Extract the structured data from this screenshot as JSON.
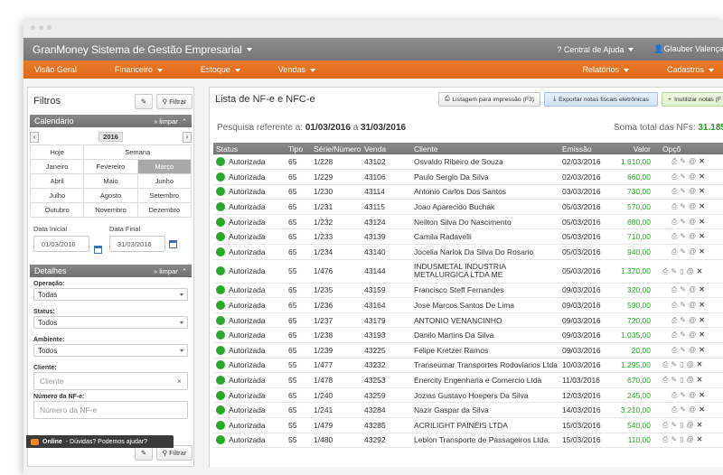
{
  "app": {
    "title": "GranMoney Sistema de Gestão Empresarial",
    "help": "Central de Ajuda",
    "user": "Glauber Valença"
  },
  "menu": {
    "left": [
      "Visão Geral",
      "Financeiro",
      "Estoque",
      "Vendas"
    ],
    "right": [
      "Relatórios",
      "Cadastros"
    ]
  },
  "sidebar": {
    "title": "Filtros",
    "filter_btn": "Filtrar",
    "calendar": {
      "title": "Calendário",
      "clear": "» limpar",
      "year": "2016",
      "quick": [
        "Hoje",
        "Semana"
      ],
      "months": [
        "Janeiro",
        "Fevereiro",
        "Março",
        "Abril",
        "Maio",
        "Junho",
        "Julho",
        "Agosto",
        "Setembro",
        "Outubro",
        "Novembro",
        "Dezembro"
      ],
      "selected_month": "Março",
      "start_label": "Data Inicial",
      "start_value": "01/03/2016",
      "end_label": "Data Final",
      "end_value": "31/03/2016"
    },
    "details": {
      "title": "Detalhes",
      "clear": "» limpar",
      "operacao_label": "Operação:",
      "operacao_value": "Todas",
      "status_label": "Status:",
      "status_value": "Todos",
      "ambiente_label": "Ambiente:",
      "ambiente_value": "Todos",
      "cliente_label": "Cliente:",
      "cliente_placeholder": "Cliente",
      "nf_label": "Número da NF-e:",
      "nf_placeholder": "Número da NF-e"
    }
  },
  "main": {
    "title": "Lista de NF-e e NFC-e",
    "actions": {
      "print": "Listagem para impressão (F3)",
      "export": "Exportar notas fiscais eletrônicas",
      "void": "Inutilizar notas (F"
    },
    "search_prefix": "Pesquisa referente a:",
    "date_from": "01/03/2016",
    "date_sep": "a",
    "date_to": "31/03/2016",
    "total_label": "Soma total das NFs:",
    "total_value": "31.185,",
    "columns": [
      "Status",
      "Tipo",
      "Série/Número",
      "Venda",
      "Cliente",
      "Emissão",
      "Valor",
      "Opçõ"
    ],
    "rows": [
      {
        "status": "Autorizada",
        "tipo": "65",
        "serie": "1/228",
        "venda": "43102",
        "cliente": "Osvaldo Ribeiro de Souza",
        "emissao": "02/03/2016",
        "valor": "1.610,00"
      },
      {
        "status": "Autorizada",
        "tipo": "65",
        "serie": "1/229",
        "venda": "43106",
        "cliente": "Paulo Sergio Da Silva",
        "emissao": "02/03/2016",
        "valor": "660,00"
      },
      {
        "status": "Autorizada",
        "tipo": "65",
        "serie": "1/230",
        "venda": "43114",
        "cliente": "Antonio Carlos Dos Santos",
        "emissao": "03/03/2016",
        "valor": "730,00"
      },
      {
        "status": "Autorizada",
        "tipo": "65",
        "serie": "1/231",
        "venda": "43115",
        "cliente": "Joao Aparecido Buchak",
        "emissao": "05/03/2016",
        "valor": "570,00"
      },
      {
        "status": "Autorizada",
        "tipo": "65",
        "serie": "1/232",
        "venda": "43124",
        "cliente": "Neilton Silva Do Nascimento",
        "emissao": "05/03/2016",
        "valor": "680,00"
      },
      {
        "status": "Autorizada",
        "tipo": "65",
        "serie": "1/233",
        "venda": "43139",
        "cliente": "Camila Radavelli",
        "emissao": "05/03/2016",
        "valor": "710,00"
      },
      {
        "status": "Autorizada",
        "tipo": "65",
        "serie": "1/234",
        "venda": "43140",
        "cliente": "Jocelia Narlok Da Silva Do Rosario",
        "emissao": "05/03/2016",
        "valor": "940,00"
      },
      {
        "status": "Autorizada",
        "tipo": "55",
        "serie": "1/476",
        "venda": "43144",
        "cliente": "INDUSMETAL INDUSTRIA METALURGICA LTDA ME",
        "emissao": "05/03/2016",
        "valor": "1.370,00",
        "tall": true
      },
      {
        "status": "Autorizada",
        "tipo": "65",
        "serie": "1/235",
        "venda": "43159",
        "cliente": "Francisco Steff Fernandes",
        "emissao": "09/03/2016",
        "valor": "320,00"
      },
      {
        "status": "Autorizada",
        "tipo": "65",
        "serie": "1/236",
        "venda": "43164",
        "cliente": "Jose Marcos Santos De Lima",
        "emissao": "09/03/2016",
        "valor": "590,00"
      },
      {
        "status": "Autorizada",
        "tipo": "65",
        "serie": "1/237",
        "venda": "43179",
        "cliente": "ANTONIO VENANCINHO",
        "emissao": "09/03/2016",
        "valor": "720,00"
      },
      {
        "status": "Autorizada",
        "tipo": "65",
        "serie": "1/238",
        "venda": "43193",
        "cliente": "Danilo Martins Da Silva",
        "emissao": "09/03/2016",
        "valor": "1.035,00"
      },
      {
        "status": "Autorizada",
        "tipo": "65",
        "serie": "1/239",
        "venda": "43225",
        "cliente": "Felipe Kretzer Ramos",
        "emissao": "09/03/2016",
        "valor": "20,00"
      },
      {
        "status": "Autorizada",
        "tipo": "55",
        "serie": "1/477",
        "venda": "43232",
        "cliente": "Transeumar Transportes Rodoviarios Ltda",
        "emissao": "10/03/2016",
        "valor": "1.295,00"
      },
      {
        "status": "Autorizada",
        "tipo": "55",
        "serie": "1/478",
        "venda": "43253",
        "cliente": "Enercity Engenharia e Comercio Ltda",
        "emissao": "11/03/2016",
        "valor": "670,00"
      },
      {
        "status": "Autorizada",
        "tipo": "65",
        "serie": "1/240",
        "venda": "43259",
        "cliente": "Jozias Gustavo Hoepers Da Silva",
        "emissao": "12/03/2016",
        "valor": "245,00"
      },
      {
        "status": "Autorizada",
        "tipo": "65",
        "serie": "1/241",
        "venda": "43284",
        "cliente": "Nazir Gaspar da Silva",
        "emissao": "14/03/2016",
        "valor": "3.210,00"
      },
      {
        "status": "Autorizada",
        "tipo": "55",
        "serie": "1/479",
        "venda": "43285",
        "cliente": "ACRILIGHT PAINÉIS LTDA",
        "emissao": "15/03/2016",
        "valor": "540,00"
      },
      {
        "status": "Autorizada",
        "tipo": "55",
        "serie": "1/480",
        "venda": "43292",
        "cliente": "Leblon Transporte de Passageiros Ltda.",
        "emissao": "15/03/2016",
        "valor": "110,00"
      }
    ]
  },
  "chat": {
    "status": "Online",
    "text": "- Dúvidas? Podemos ajudar?"
  },
  "colors": {
    "accent_orange": "#e46f1f",
    "status_green": "#28a828",
    "header_gray": "#808080"
  }
}
